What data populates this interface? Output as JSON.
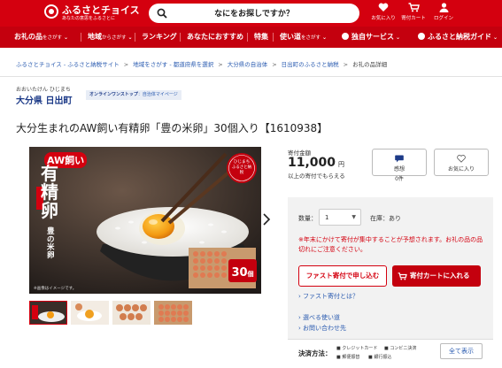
{
  "header": {
    "logo_title": "ふるさとチョイス",
    "logo_subtitle": "あなたの意思をふるさとに",
    "search_placeholder": "なにをお探しですか？",
    "icons": [
      {
        "name": "heart-icon",
        "label": "お気に入り"
      },
      {
        "name": "cart-icon",
        "label": "寄付カート"
      },
      {
        "name": "user-icon",
        "label": "ログイン"
      }
    ],
    "brand_color": "#d4000f"
  },
  "nav": {
    "items": [
      {
        "label": "お礼の品",
        "suffix": "をさがす"
      },
      {
        "label": "地域",
        "suffix": "からさがす"
      },
      {
        "label": "ランキング",
        "suffix": ""
      },
      {
        "label": "あなたにおすすめ",
        "suffix": ""
      },
      {
        "label": "特集",
        "suffix": ""
      },
      {
        "label": "使い道",
        "suffix": "をさがす"
      }
    ],
    "right": [
      {
        "label": "独自サービス"
      },
      {
        "label": "ふるさと納税ガイド"
      }
    ]
  },
  "breadcrumb": [
    "ふるさとチョイス - ふるさと納税サイト",
    "地域をさがす - 都道府県を選択",
    "大分県の自治体",
    "日出町のふるさと納税",
    "お礼の品詳細"
  ],
  "municipality": {
    "kana": "おおいたけん ひじまち",
    "name": "大分県 日出町",
    "pill_strong": "オンラインワンストップ",
    "pill_rest": "：自治体マイページ"
  },
  "product": {
    "title": "大分生まれのAW飼い有精卵「豊の米卵」30個入り【1610938】",
    "image_texts": {
      "aw": "AW飼い",
      "main": "有精卵",
      "sub": "豊の米卵",
      "badge_top": "ひじまち",
      "badge_bottom": "ふるさと納税",
      "count": "30",
      "count_unit": "個",
      "note": "※画像はイメージです。"
    }
  },
  "donation": {
    "label": "寄付金額",
    "amount": "11,000",
    "unit": "円",
    "note": "以上の寄付でもらえる",
    "thanks_label": "感想",
    "thanks_count": "0件",
    "fav_label": "お気に入り"
  },
  "order": {
    "qty_label": "数量：",
    "qty_value": "1",
    "stock_label": "在庫：あり",
    "notice": "※年末にかけて寄付が集中することが予想されます。お礼の品の品切れにご注意ください。",
    "fast_button": "ファスト寄付で申し込む",
    "cart_button": "寄付カートに入れる",
    "fast_link": "ファスト寄付とは？",
    "usage_link": "選べる使い道",
    "contact_link": "お問い合わせ先"
  },
  "payment": {
    "label": "決済方法：",
    "methods": [
      "クレジットカード",
      "コンビニ決済",
      "郵便振替",
      "銀行振込"
    ],
    "all_link": "全て表示"
  }
}
